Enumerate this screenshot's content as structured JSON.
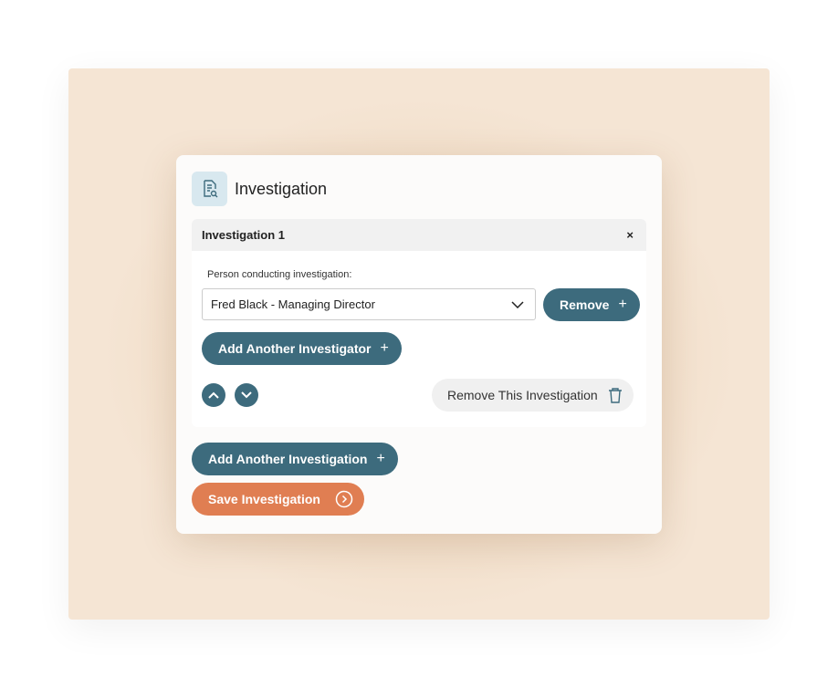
{
  "header": {
    "title": "Investigation",
    "icon": "document-search-icon"
  },
  "investigation": {
    "title": "Investigation 1",
    "close_label": "×",
    "person_label": "Person conducting investigation:",
    "person_value": "Fred Black - Managing Director",
    "remove_label": "Remove",
    "add_investigator_label": "Add Another Investigator",
    "remove_investigation_label": "Remove This Investigation"
  },
  "actions": {
    "add_investigation_label": "Add Another Investigation",
    "save_label": "Save Investigation"
  },
  "colors": {
    "primary": "#3d6b7d",
    "accent": "#e07e52",
    "background": "#f5e5d4"
  }
}
